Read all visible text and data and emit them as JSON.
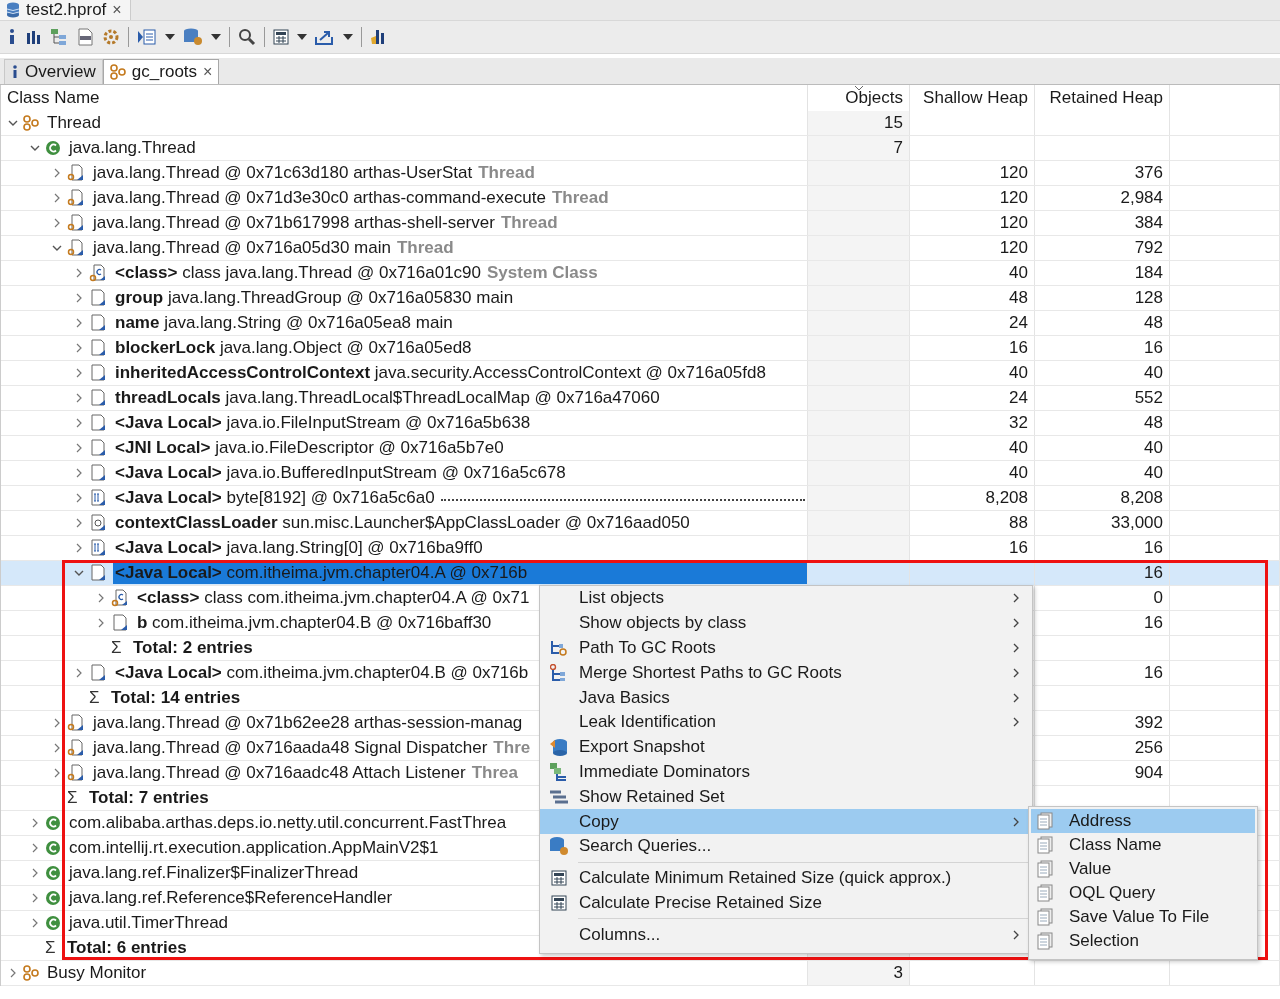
{
  "editor_tab": {
    "title": "test2.hprof",
    "close": "×"
  },
  "tabs": [
    {
      "label": "Overview",
      "kind": "info",
      "selected": false
    },
    {
      "label": "gc_roots",
      "kind": "group",
      "selected": true,
      "close": "×"
    }
  ],
  "table": {
    "columns": [
      "Class Name",
      "Objects",
      "Shallow Heap",
      "Retained Heap"
    ],
    "tree": [
      {
        "kind": "group",
        "text": "Thread",
        "expanded": true,
        "selected": false,
        "objects": "15",
        "children": [
          {
            "kind": "class",
            "text": "java.lang.Thread",
            "expanded": true,
            "selected": false,
            "objects": "7",
            "children": [
              {
                "kind": "thread",
                "text": "java.lang.Thread @ 0x71c63d180  arthas-UserStat",
                "note": "Thread",
                "expanded": false,
                "selected": false,
                "shallow": "120",
                "retained": "376"
              },
              {
                "kind": "thread",
                "text": "java.lang.Thread @ 0x71d3e30c0  arthas-command-execute",
                "note": "Thread",
                "expanded": false,
                "selected": false,
                "shallow": "120",
                "retained": "2,984"
              },
              {
                "kind": "thread",
                "text": "java.lang.Thread @ 0x71b617998  arthas-shell-server",
                "note": "Thread",
                "expanded": false,
                "selected": false,
                "shallow": "120",
                "retained": "384"
              },
              {
                "kind": "thread",
                "text": "java.lang.Thread @ 0x716a05d30  main",
                "note": "Thread",
                "expanded": true,
                "selected": false,
                "shallow": "120",
                "retained": "792",
                "children": [
                  {
                    "kind": "class-ref",
                    "text": "**<class>** class java.lang.Thread @ 0x716a01c90",
                    "note": "System Class",
                    "expanded": false,
                    "selected": false,
                    "shallow": "40",
                    "retained": "184"
                  },
                  {
                    "kind": "object",
                    "text": "**group** java.lang.ThreadGroup @ 0x716a05830  main",
                    "expanded": false,
                    "selected": false,
                    "shallow": "48",
                    "retained": "128"
                  },
                  {
                    "kind": "object",
                    "text": "**name** java.lang.String @ 0x716a05ea8  main",
                    "expanded": false,
                    "selected": false,
                    "shallow": "24",
                    "retained": "48"
                  },
                  {
                    "kind": "object",
                    "text": "**blockerLock** java.lang.Object @ 0x716a05ed8",
                    "expanded": false,
                    "selected": false,
                    "shallow": "16",
                    "retained": "16"
                  },
                  {
                    "kind": "object",
                    "text": "**inheritedAccessControlContext** java.security.AccessControlContext @ 0x716a05fd8",
                    "expanded": false,
                    "selected": false,
                    "shallow": "40",
                    "retained": "40"
                  },
                  {
                    "kind": "object",
                    "text": "**threadLocals** java.lang.ThreadLocal$ThreadLocalMap @ 0x716a47060",
                    "expanded": false,
                    "selected": false,
                    "shallow": "24",
                    "retained": "552"
                  },
                  {
                    "kind": "object",
                    "text": "**<Java Local>** java.io.FileInputStream @ 0x716a5b638",
                    "expanded": false,
                    "selected": false,
                    "shallow": "32",
                    "retained": "48"
                  },
                  {
                    "kind": "object",
                    "text": "**<JNI Local>** java.io.FileDescriptor @ 0x716a5b7e0",
                    "expanded": false,
                    "selected": false,
                    "shallow": "40",
                    "retained": "40"
                  },
                  {
                    "kind": "object",
                    "text": "**<Java Local>** java.io.BufferedInputStream @ 0x716a5c678",
                    "expanded": false,
                    "selected": false,
                    "shallow": "40",
                    "retained": "40"
                  },
                  {
                    "kind": "array",
                    "text": "**<Java Local>** byte[8192] @ 0x716a5c6a0",
                    "leader": true,
                    "expanded": false,
                    "selected": false,
                    "shallow": "8,208",
                    "retained": "8,208"
                  },
                  {
                    "kind": "loader",
                    "text": "**contextClassLoader** sun.misc.Launcher$AppClassLoader @ 0x716aad050",
                    "expanded": false,
                    "selected": false,
                    "shallow": "88",
                    "retained": "33,000"
                  },
                  {
                    "kind": "array",
                    "text": "**<Java Local>** java.lang.String[0] @ 0x716ba9ff0",
                    "expanded": false,
                    "selected": false,
                    "shallow": "16",
                    "retained": "16"
                  },
                  {
                    "kind": "object",
                    "text": "**<Java Local>** com.itheima.jvm.chapter04.A @ 0x716b",
                    "expanded": true,
                    "selected": true,
                    "retained": "16",
                    "children": [
                      {
                        "kind": "class-ref",
                        "text": "**<class>** class com.itheima.jvm.chapter04.A @ 0x71",
                        "expanded": false,
                        "selected": false,
                        "retained": "0"
                      },
                      {
                        "kind": "object",
                        "text": "**b** com.itheima.jvm.chapter04.B @ 0x716baff30",
                        "expanded": false,
                        "selected": false,
                        "retained": "16"
                      },
                      {
                        "kind": "total",
                        "symbol": "Σ",
                        "text": "Total: 2 entries"
                      }
                    ]
                  },
                  {
                    "kind": "object",
                    "text": "**<Java Local>** com.itheima.jvm.chapter04.B @ 0x716b",
                    "expanded": false,
                    "selected": false,
                    "retained": "16"
                  },
                  {
                    "kind": "total",
                    "symbol": "Σ",
                    "text": "Total: 14 entries"
                  }
                ]
              },
              {
                "kind": "thread",
                "text": "java.lang.Thread @ 0x71b62ee28  arthas-session-manag",
                "expanded": false,
                "selected": false,
                "retained": "392"
              },
              {
                "kind": "thread",
                "text": "java.lang.Thread @ 0x716aada48  Signal Dispatcher",
                "note": "Thre",
                "expanded": false,
                "selected": false,
                "retained": "256"
              },
              {
                "kind": "thread",
                "text": "java.lang.Thread @ 0x716aadc48  Attach Listener",
                "note": "Threa",
                "expanded": false,
                "selected": false,
                "retained": "904"
              },
              {
                "kind": "total",
                "symbol": "Σ",
                "text": "Total: 7 entries"
              }
            ]
          },
          {
            "kind": "class",
            "text": "com.alibaba.arthas.deps.io.netty.util.concurrent.FastThrea",
            "expanded": false,
            "selected": false
          },
          {
            "kind": "class",
            "text": "com.intellij.rt.execution.application.AppMainV2$1",
            "expanded": false,
            "selected": false
          },
          {
            "kind": "class",
            "text": "java.lang.ref.Finalizer$FinalizerThread",
            "expanded": false,
            "selected": false
          },
          {
            "kind": "class",
            "text": "java.lang.ref.Reference$ReferenceHandler",
            "expanded": false,
            "selected": false
          },
          {
            "kind": "class",
            "text": "java.util.TimerThread",
            "expanded": false,
            "selected": false
          },
          {
            "kind": "total",
            "symbol": "Σ",
            "text": "Total: 6 entries"
          }
        ]
      },
      {
        "kind": "group",
        "text": "Busy Monitor",
        "expanded": false,
        "selected": false,
        "objects": "3"
      }
    ]
  },
  "context_menu": {
    "items": [
      {
        "label": "List objects",
        "kind": "plain",
        "submenu": true,
        "divider_before": false,
        "selected": false
      },
      {
        "label": "Show objects by class",
        "kind": "plain",
        "submenu": true,
        "divider_before": false,
        "selected": false
      },
      {
        "label": "Path To GC Roots",
        "kind": "path",
        "submenu": true,
        "divider_before": false,
        "selected": false
      },
      {
        "label": "Merge Shortest Paths to GC Roots",
        "kind": "merge",
        "submenu": true,
        "divider_before": false,
        "selected": false
      },
      {
        "label": "Java Basics",
        "kind": "plain",
        "submenu": true,
        "divider_before": false,
        "selected": false
      },
      {
        "label": "Leak Identification",
        "kind": "plain",
        "submenu": true,
        "divider_before": false,
        "selected": false
      },
      {
        "label": "Export Snapshot",
        "kind": "export",
        "submenu": false,
        "divider_before": false,
        "selected": false
      },
      {
        "label": "Immediate Dominators",
        "kind": "dominators",
        "submenu": false,
        "divider_before": false,
        "selected": false
      },
      {
        "label": "Show Retained Set",
        "kind": "retained",
        "submenu": false,
        "divider_before": false,
        "selected": false
      },
      {
        "label": "Copy",
        "kind": "plain",
        "submenu": true,
        "divider_before": false,
        "selected": true
      },
      {
        "label": "Search Queries...",
        "kind": "search-db",
        "submenu": false,
        "divider_before": false,
        "selected": false
      },
      {
        "label": "Calculate Minimum Retained Size (quick approx.)",
        "kind": "calc",
        "submenu": false,
        "divider_before": true,
        "selected": false
      },
      {
        "label": "Calculate Precise Retained Size",
        "kind": "calc",
        "submenu": false,
        "divider_before": false,
        "selected": false
      },
      {
        "label": "Columns...",
        "kind": "plain",
        "submenu": true,
        "divider_before": true,
        "selected": false
      }
    ]
  },
  "copy_submenu": {
    "items": [
      {
        "label": "Address",
        "selected": true
      },
      {
        "label": "Class Name",
        "selected": false
      },
      {
        "label": "Value",
        "selected": false
      },
      {
        "label": "OQL Query",
        "selected": false
      },
      {
        "label": "Save Value To File",
        "selected": false
      },
      {
        "label": "Selection",
        "selected": false
      }
    ]
  }
}
